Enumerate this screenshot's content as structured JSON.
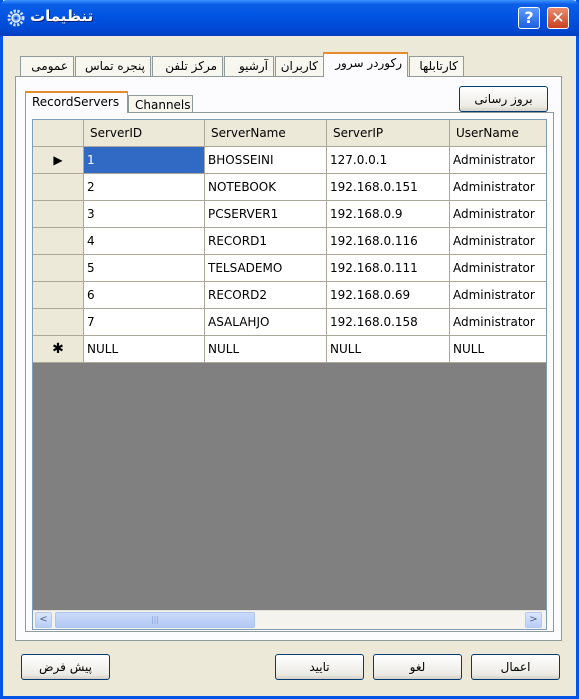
{
  "window": {
    "title": "تنظیمات",
    "help_glyph": "?",
    "close_glyph": "✕"
  },
  "tabs": [
    {
      "label": "کارتابلها"
    },
    {
      "label": "رکوردر سرور"
    },
    {
      "label": "کاربران"
    },
    {
      "label": "آرشیو"
    },
    {
      "label": "مرکز تلفن"
    },
    {
      "label": "پنجره تماس"
    },
    {
      "label": "عمومی"
    }
  ],
  "selected_tab": "رکوردر سرور",
  "subtabs": [
    {
      "label": "RecordServers"
    },
    {
      "label": "Channels"
    }
  ],
  "selected_subtab": "RecordServers",
  "refresh_button": "بروز رسانی",
  "grid": {
    "columns": [
      "ServerID",
      "ServerName",
      "ServerIP",
      "UserName"
    ],
    "rows": [
      [
        "1",
        "BHOSSEINI",
        "127.0.0.1",
        "Administrator"
      ],
      [
        "2",
        "NOTEBOOK",
        "192.168.0.151",
        "Administrator"
      ],
      [
        "3",
        "PCSERVER1",
        "192.168.0.9",
        "Administrator"
      ],
      [
        "4",
        "RECORD1",
        "192.168.0.116",
        "Administrator"
      ],
      [
        "5",
        "TELSADEMO",
        "192.168.0.111",
        "Administrator"
      ],
      [
        "6",
        "RECORD2",
        "192.168.0.69",
        "Administrator"
      ],
      [
        "7",
        "ASALAHJO",
        "192.168.0.158",
        "Administrator"
      ]
    ],
    "new_row": [
      "NULL",
      "NULL",
      "NULL",
      "NULL"
    ],
    "current_row_marker": "▶",
    "new_row_marker": "✱",
    "scroll_left": "<",
    "scroll_right": ">",
    "thumb_grip": "|||"
  },
  "buttons": {
    "default": "پیش فرض",
    "ok": "تایید",
    "cancel": "لغو",
    "apply": "اعمال"
  }
}
